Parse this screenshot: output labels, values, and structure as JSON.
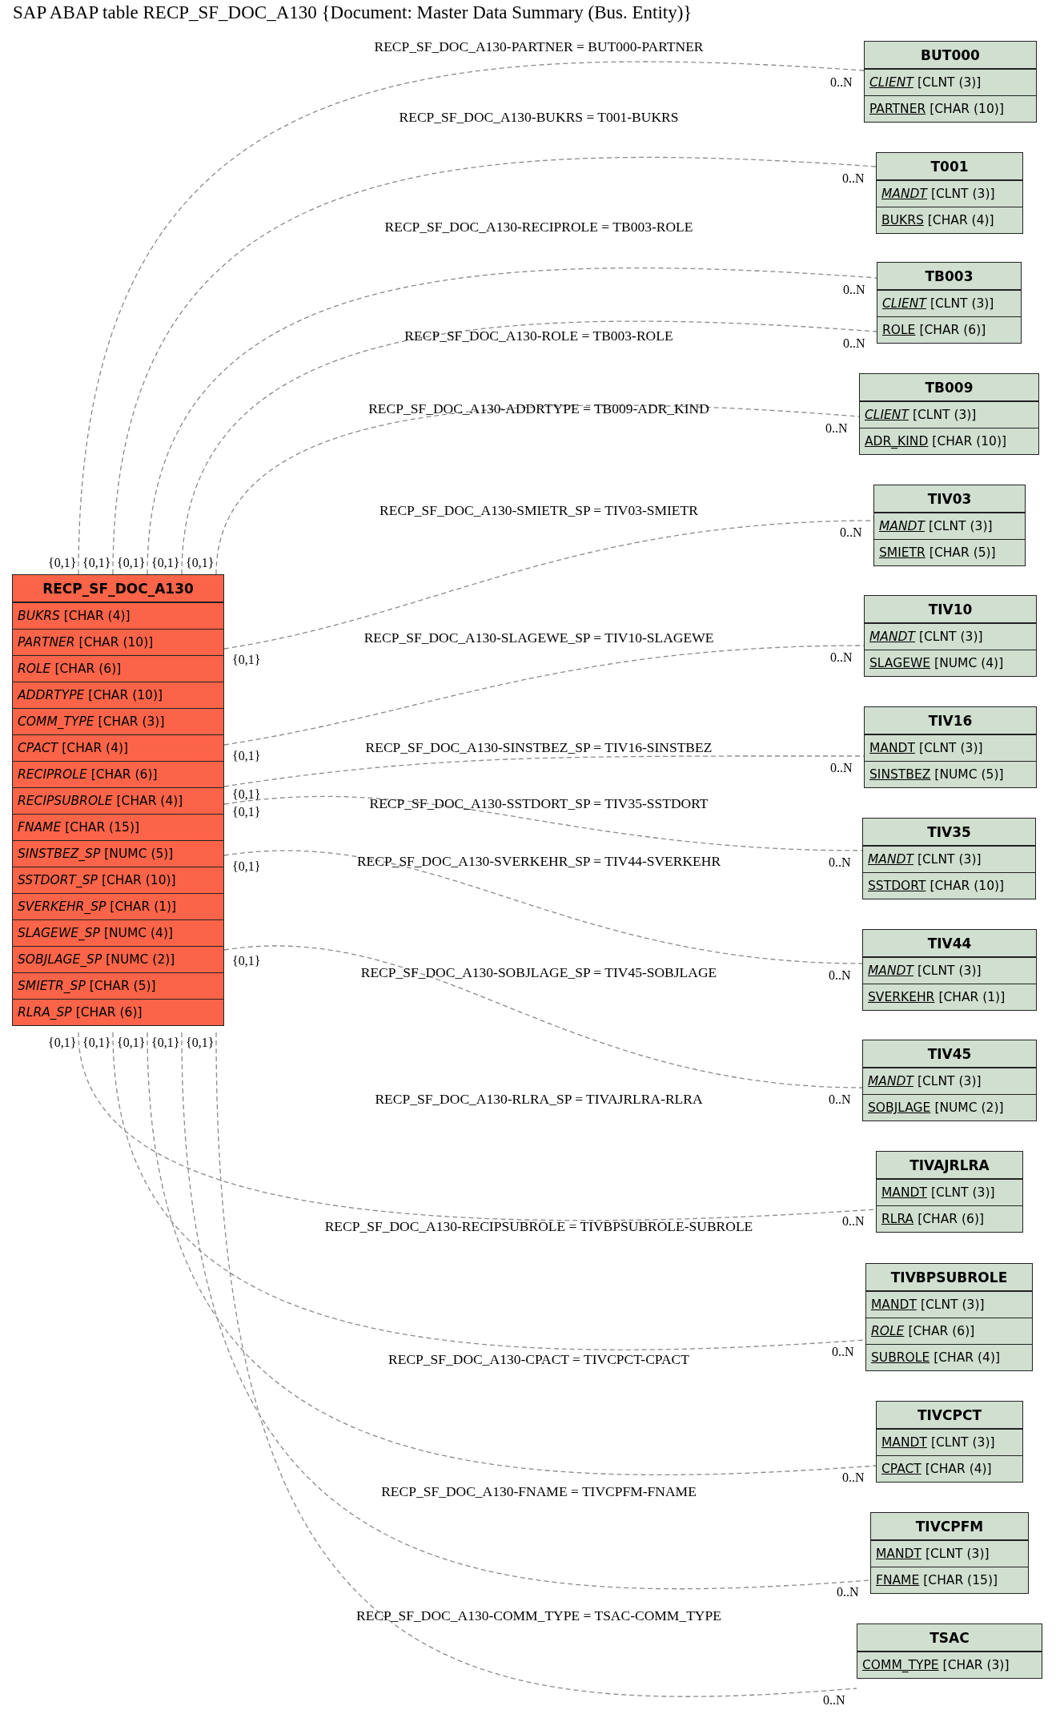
{
  "title": "SAP ABAP table RECP_SF_DOC_A130 {Document: Master Data Summary (Bus. Entity)}",
  "tables": [
    {
      "name": "RECP_SF_DOC_A130",
      "kind": "main",
      "fields": [
        {
          "name": "BUKRS",
          "type": "[CHAR (4)]",
          "key": false,
          "check": true
        },
        {
          "name": "PARTNER",
          "type": "[CHAR (10)]",
          "key": false,
          "check": true
        },
        {
          "name": "ROLE",
          "type": "[CHAR (6)]",
          "key": false,
          "check": true
        },
        {
          "name": "ADDRTYPE",
          "type": "[CHAR (10)]",
          "key": false,
          "check": true
        },
        {
          "name": "COMM_TYPE",
          "type": "[CHAR (3)]",
          "key": false,
          "check": true
        },
        {
          "name": "CPACT",
          "type": "[CHAR (4)]",
          "key": false,
          "check": true
        },
        {
          "name": "RECIPROLE",
          "type": "[CHAR (6)]",
          "key": false,
          "check": true
        },
        {
          "name": "RECIPSUBROLE",
          "type": "[CHAR (4)]",
          "key": false,
          "check": true
        },
        {
          "name": "FNAME",
          "type": "[CHAR (15)]",
          "key": false,
          "check": true
        },
        {
          "name": "SINSTBEZ_SP",
          "type": "[NUMC (5)]",
          "key": false,
          "check": true
        },
        {
          "name": "SSTDORT_SP",
          "type": "[CHAR (10)]",
          "key": false,
          "check": true
        },
        {
          "name": "SVERKEHR_SP",
          "type": "[CHAR (1)]",
          "key": false,
          "check": true
        },
        {
          "name": "SLAGEWE_SP",
          "type": "[NUMC (4)]",
          "key": false,
          "check": true
        },
        {
          "name": "SOBJLAGE_SP",
          "type": "[NUMC (2)]",
          "key": false,
          "check": true
        },
        {
          "name": "SMIETR_SP",
          "type": "[CHAR (5)]",
          "key": false,
          "check": true
        },
        {
          "name": "RLRA_SP",
          "type": "[CHAR (6)]",
          "key": false,
          "check": true
        }
      ]
    },
    {
      "name": "BUT000",
      "kind": "related",
      "fields": [
        {
          "name": "CLIENT",
          "type": "[CLNT (3)]",
          "key": true,
          "check": true
        },
        {
          "name": "PARTNER",
          "type": "[CHAR (10)]",
          "key": true,
          "check": false
        }
      ]
    },
    {
      "name": "T001",
      "kind": "related",
      "fields": [
        {
          "name": "MANDT",
          "type": "[CLNT (3)]",
          "key": true,
          "check": true
        },
        {
          "name": "BUKRS",
          "type": "[CHAR (4)]",
          "key": true,
          "check": false
        }
      ]
    },
    {
      "name": "TB003",
      "kind": "related",
      "fields": [
        {
          "name": "CLIENT",
          "type": "[CLNT (3)]",
          "key": true,
          "check": true
        },
        {
          "name": "ROLE",
          "type": "[CHAR (6)]",
          "key": true,
          "check": false
        }
      ]
    },
    {
      "name": "TB009",
      "kind": "related",
      "fields": [
        {
          "name": "CLIENT",
          "type": "[CLNT (3)]",
          "key": true,
          "check": true
        },
        {
          "name": "ADR_KIND",
          "type": "[CHAR (10)]",
          "key": true,
          "check": false
        }
      ]
    },
    {
      "name": "TIV03",
      "kind": "related",
      "fields": [
        {
          "name": "MANDT",
          "type": "[CLNT (3)]",
          "key": true,
          "check": true
        },
        {
          "name": "SMIETR",
          "type": "[CHAR (5)]",
          "key": true,
          "check": false
        }
      ]
    },
    {
      "name": "TIV10",
      "kind": "related",
      "fields": [
        {
          "name": "MANDT",
          "type": "[CLNT (3)]",
          "key": true,
          "check": true
        },
        {
          "name": "SLAGEWE",
          "type": "[NUMC (4)]",
          "key": true,
          "check": false
        }
      ]
    },
    {
      "name": "TIV16",
      "kind": "related",
      "fields": [
        {
          "name": "MANDT",
          "type": "[CLNT (3)]",
          "key": true,
          "check": false
        },
        {
          "name": "SINSTBEZ",
          "type": "[NUMC (5)]",
          "key": true,
          "check": false
        }
      ]
    },
    {
      "name": "TIV35",
      "kind": "related",
      "fields": [
        {
          "name": "MANDT",
          "type": "[CLNT (3)]",
          "key": true,
          "check": true
        },
        {
          "name": "SSTDORT",
          "type": "[CHAR (10)]",
          "key": true,
          "check": false
        }
      ]
    },
    {
      "name": "TIV44",
      "kind": "related",
      "fields": [
        {
          "name": "MANDT",
          "type": "[CLNT (3)]",
          "key": true,
          "check": true
        },
        {
          "name": "SVERKEHR",
          "type": "[CHAR (1)]",
          "key": true,
          "check": false
        }
      ]
    },
    {
      "name": "TIV45",
      "kind": "related",
      "fields": [
        {
          "name": "MANDT",
          "type": "[CLNT (3)]",
          "key": true,
          "check": true
        },
        {
          "name": "SOBJLAGE",
          "type": "[NUMC (2)]",
          "key": true,
          "check": false
        }
      ]
    },
    {
      "name": "TIVAJRLRA",
      "kind": "related",
      "fields": [
        {
          "name": "MANDT",
          "type": "[CLNT (3)]",
          "key": true,
          "check": false
        },
        {
          "name": "RLRA",
          "type": "[CHAR (6)]",
          "key": true,
          "check": false
        }
      ]
    },
    {
      "name": "TIVBPSUBROLE",
      "kind": "related",
      "fields": [
        {
          "name": "MANDT",
          "type": "[CLNT (3)]",
          "key": true,
          "check": false
        },
        {
          "name": "ROLE",
          "type": "[CHAR (6)]",
          "key": true,
          "check": true
        },
        {
          "name": "SUBROLE",
          "type": "[CHAR (4)]",
          "key": true,
          "check": false
        }
      ]
    },
    {
      "name": "TIVCPCT",
      "kind": "related",
      "fields": [
        {
          "name": "MANDT",
          "type": "[CLNT (3)]",
          "key": true,
          "check": false
        },
        {
          "name": "CPACT",
          "type": "[CHAR (4)]",
          "key": true,
          "check": false
        }
      ]
    },
    {
      "name": "TIVCPFM",
      "kind": "related",
      "fields": [
        {
          "name": "MANDT",
          "type": "[CLNT (3)]",
          "key": true,
          "check": false
        },
        {
          "name": "FNAME",
          "type": "[CHAR (15)]",
          "key": true,
          "check": false
        }
      ]
    },
    {
      "name": "TSAC",
      "kind": "related",
      "fields": [
        {
          "name": "COMM_TYPE",
          "type": "[CHAR (3)]",
          "key": true,
          "check": false
        }
      ]
    }
  ],
  "relations": [
    {
      "label": "RECP_SF_DOC_A130-PARTNER = BUT000-PARTNER",
      "from": "{0,1}",
      "to": "0..N"
    },
    {
      "label": "RECP_SF_DOC_A130-BUKRS = T001-BUKRS",
      "from": "{0,1}",
      "to": "0..N"
    },
    {
      "label": "RECP_SF_DOC_A130-RECIPROLE = TB003-ROLE",
      "from": "{0,1}",
      "to": "0..N"
    },
    {
      "label": "RECP_SF_DOC_A130-ROLE = TB003-ROLE",
      "from": "{0,1}",
      "to": "0..N"
    },
    {
      "label": "RECP_SF_DOC_A130-ADDRTYPE = TB009-ADR_KIND",
      "from": "{0,1}",
      "to": "0..N"
    },
    {
      "label": "RECP_SF_DOC_A130-SMIETR_SP = TIV03-SMIETR",
      "from": "{0,1}",
      "to": "0..N"
    },
    {
      "label": "RECP_SF_DOC_A130-SLAGEWE_SP = TIV10-SLAGEWE",
      "from": "{0,1}",
      "to": "0..N"
    },
    {
      "label": "RECP_SF_DOC_A130-SINSTBEZ_SP = TIV16-SINSTBEZ",
      "from": "{0,1}",
      "to": "0..N"
    },
    {
      "label": "RECP_SF_DOC_A130-SSTDORT_SP = TIV35-SSTDORT",
      "from": "{0,1}",
      "to": "0..N"
    },
    {
      "label": "RECP_SF_DOC_A130-SVERKEHR_SP = TIV44-SVERKEHR",
      "from": "{0,1}",
      "to": "0..N"
    },
    {
      "label": "RECP_SF_DOC_A130-SOBJLAGE_SP = TIV45-SOBJLAGE",
      "from": "{0,1}",
      "to": "0..N"
    },
    {
      "label": "RECP_SF_DOC_A130-RLRA_SP = TIVAJRLRA-RLRA",
      "from": "{0,1}",
      "to": "0..N"
    },
    {
      "label": "RECP_SF_DOC_A130-RECIPSUBROLE = TIVBPSUBROLE-SUBROLE",
      "from": "{0,1}",
      "to": "0..N"
    },
    {
      "label": "RECP_SF_DOC_A130-CPACT = TIVCPCT-CPACT",
      "from": "{0,1}",
      "to": "0..N"
    },
    {
      "label": "RECP_SF_DOC_A130-FNAME = TIVCPFM-FNAME",
      "from": "{0,1}",
      "to": "0..N"
    },
    {
      "label": "RECP_SF_DOC_A130-COMM_TYPE = TSAC-COMM_TYPE",
      "from": "{0,1}",
      "to": "0..N"
    }
  ]
}
